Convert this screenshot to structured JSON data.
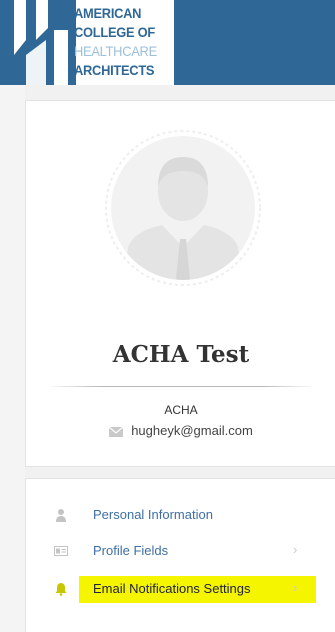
{
  "header": {
    "logo_lines": [
      "AMERICAN",
      "COLLEGE OF",
      "HEALTHCARE",
      "ARCHITECTS"
    ],
    "background_color": "#2f6896"
  },
  "profile": {
    "avatar_icon": "user-avatar-icon",
    "name": "ACHA Test",
    "organization": "ACHA",
    "email_icon": "envelope-icon",
    "email": "hugheyk@gmail.com"
  },
  "menu": {
    "items": [
      {
        "label": "Personal Information",
        "icon": "person-icon",
        "has_chevron": false
      },
      {
        "label": "Profile Fields",
        "icon": "id-card-icon",
        "has_chevron": true
      },
      {
        "label": "Email Notifications Settings",
        "icon": "bell-icon",
        "has_chevron": true,
        "highlighted": true
      }
    ],
    "link_color": "#3f6fa3",
    "highlight_color": "#f5f500"
  }
}
